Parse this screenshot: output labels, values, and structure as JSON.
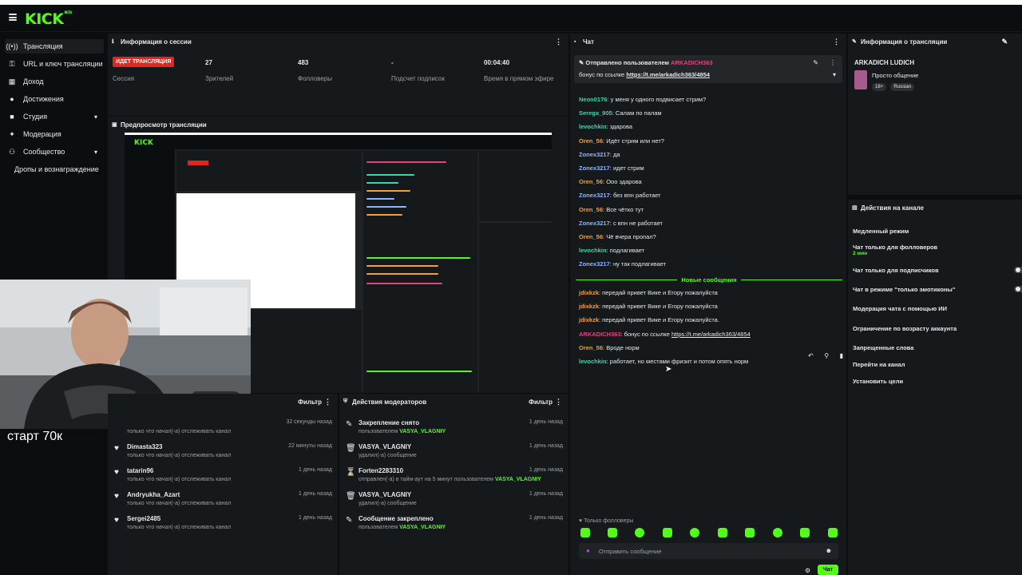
{
  "app": {
    "logo": "KICK",
    "logo_sup": "BETA"
  },
  "sidebar": {
    "items": [
      {
        "label": "Трансляция",
        "icon": "broadcast-icon"
      },
      {
        "label": "URL и ключ трансляции",
        "icon": "key-icon"
      },
      {
        "label": "Доход",
        "icon": "revenue-icon"
      },
      {
        "label": "Достижения",
        "icon": "achievements-icon"
      },
      {
        "label": "Студия",
        "icon": "studio-icon"
      },
      {
        "label": "Модерация",
        "icon": "moderation-icon"
      },
      {
        "label": "Сообщество",
        "icon": "community-icon"
      },
      {
        "label": "Дропы и вознаграждение",
        "icon": ""
      }
    ]
  },
  "session": {
    "title": "Информация о сессии",
    "live_badge": "ИДЕТ ТРАНСЛЯЦИЯ",
    "live_label": "Сессия",
    "viewers_value": "27",
    "viewers_label": "Зрителей",
    "followers_value": "483",
    "followers_label": "Фолловеры",
    "subs_value": "-",
    "subs_label": "Подсчет подписок",
    "time_value": "00:04:40",
    "time_label": "Время в прямом эфире"
  },
  "preview": {
    "title": "Предпросмотр трансляции"
  },
  "webcam": {
    "overlay_text": "старт 70к"
  },
  "followers_panel": {
    "filter": "Фильтр",
    "rows": [
      {
        "name": "",
        "sub": "только что начал(-а) отслеживать канал",
        "time": "32 секунды назад"
      },
      {
        "name": "Dimasta323",
        "sub": "только что начал(-а) отслеживать канал",
        "time": "22 минуты назад"
      },
      {
        "name": "tatarin96",
        "sub": "только что начал(-а) отслеживать канал",
        "time": "1 день назад"
      },
      {
        "name": "Andryukha_Azart",
        "sub": "только что начал(-а) отслеживать канал",
        "time": "1 день назад"
      },
      {
        "name": "Sergei2485",
        "sub": "только что начал(-а) отслеживать канал",
        "time": "1 день назад"
      }
    ]
  },
  "mod_panel": {
    "title": "Действия модераторов",
    "filter": "Фильтр",
    "rows": [
      {
        "name": "Закрепление снято",
        "sub_prefix": "пользователем ",
        "sub_user": "VASYA_VLAGNIY",
        "time": "1 день назад",
        "icon": "pin-icon"
      },
      {
        "name": "VASYA_VLAGNIY",
        "sub_prefix": "удалил(-а) сообщение",
        "sub_user": "",
        "time": "1 день назад",
        "icon": "trash-icon"
      },
      {
        "name": "Forten2283310",
        "sub_prefix": "отправлен(-а) в тайм-аут на 5 минут пользователем ",
        "sub_user": "VASYA_VLAGNIY",
        "time": "1 день назад",
        "icon": "hourglass-icon"
      },
      {
        "name": "VASYA_VLAGNIY",
        "sub_prefix": "удалил(-а) сообщение",
        "sub_user": "",
        "time": "1 день назад",
        "icon": "trash-icon"
      },
      {
        "name": "Сообщение закреплено",
        "sub_prefix": "пользователем ",
        "sub_user": "VASYA_VLAGNIY",
        "time": "1 день назад",
        "icon": "pin-icon"
      }
    ]
  },
  "chat": {
    "title": "Чат",
    "pinned_by": "Отправлено пользователем",
    "pinned_user": "ARKADICH363",
    "pinned_text": "бонус по ссылке ",
    "pinned_link": "https://t.me/arkadich363/4854",
    "messages_old": [
      {
        "user": "Neon0176",
        "color": "#3fd6a6",
        "text": ": у меня у одного подвисает стрим?"
      },
      {
        "user": "Serega_905",
        "color": "#3fd6a6",
        "text": ": Салам по палам"
      },
      {
        "user": "levochkin",
        "color": "#3fd6a6",
        "text": ": здарова"
      },
      {
        "user": "Oren_56",
        "color": "#f0a040",
        "text": ": Идёт стрим или нет?"
      },
      {
        "user": "Zonex3217",
        "color": "#8fb4ff",
        "text": ": да"
      },
      {
        "user": "Zonex3217",
        "color": "#8fb4ff",
        "text": ": идет стрим"
      },
      {
        "user": "Oren_56",
        "color": "#f0a040",
        "text": ": Ооо здарова"
      },
      {
        "user": "Zonex3217",
        "color": "#8fb4ff",
        "text": ": без впн работает"
      },
      {
        "user": "Oren_56",
        "color": "#f0a040",
        "text": ": Все чётко тут"
      },
      {
        "user": "Zonex3217",
        "color": "#8fb4ff",
        "text": ": с впн не работает"
      },
      {
        "user": "Oren_56",
        "color": "#f0a040",
        "text": ": Чё вчера пропал?"
      },
      {
        "user": "levochkin",
        "color": "#3fd6a6",
        "text": ": подлагивает"
      },
      {
        "user": "Zonex3217",
        "color": "#8fb4ff",
        "text": ": ну так подлагивает"
      }
    ],
    "new_messages_label": "Новые сообщения",
    "messages_new": [
      {
        "user": "jdixkzk",
        "color": "#f0a040",
        "text": ": передай привет Вике и Егору пожалуйста"
      },
      {
        "user": "jdixkzk",
        "color": "#f0a040",
        "text": ": передай привет Вике и Егору пожалуйста"
      },
      {
        "user": "jdixkzk",
        "color": "#f0a040",
        "text": ": передай привет Вике и Егору пожалуйста."
      },
      {
        "user": "ARKADICH363",
        "color": "#e0457b",
        "text": ": бонус по ссылке ",
        "link": "https://t.me/arkadich363/4854"
      },
      {
        "user": "Oren_56",
        "color": "#f0a040",
        "text": ": Вроде норм"
      },
      {
        "user": "levochkin",
        "color": "#3fd6a6",
        "text": ": работает, но местами фризит и потом опять норм"
      }
    ],
    "followers_only": "Только фолловеры",
    "input_placeholder": "Отправить сообщение",
    "send_label": "Чат"
  },
  "stream_info": {
    "title": "Информация о трансляции",
    "channel": "ARKADICH LUDICH",
    "stream_title": "Просто общение",
    "tags": [
      "18+",
      "Russian"
    ]
  },
  "channel_actions": {
    "title": "Действия на канале",
    "slow_mode": "Медленный режим",
    "followers_only": "Чат только для фолловеров",
    "followers_only_sub": "2 мин",
    "subs_only": "Чат только для подписчиков",
    "emote_only": "Чат в режиме \"только эмотиконы\"",
    "ai_mod": "Модерация чата с помощью ИИ",
    "age_limit": "Ограничение по возрасту аккаунта",
    "banned_words": "Запрещенные слова",
    "go_channel": "Перейти на канал",
    "set_goals": "Установить цели"
  },
  "colors": {
    "accent": "#53fc18",
    "live": "#e1261c",
    "panel": "#16191b",
    "bg": "#0b0e0f"
  }
}
